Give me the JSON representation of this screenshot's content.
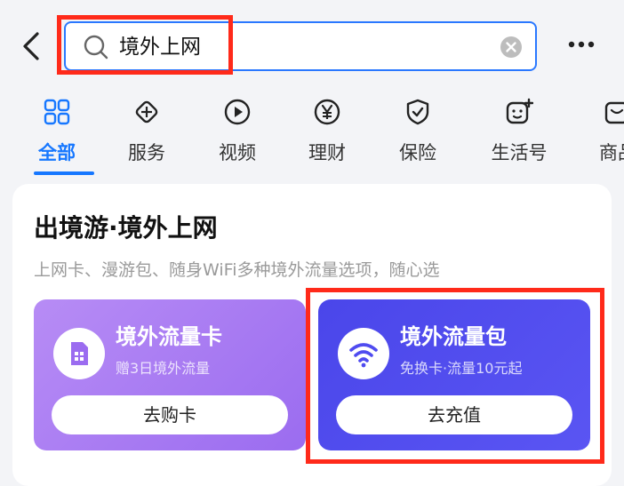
{
  "search": {
    "query": "境外上网"
  },
  "tabs": [
    {
      "label": "全部",
      "icon": "grid-icon",
      "active": true
    },
    {
      "label": "服务",
      "icon": "cube-icon"
    },
    {
      "label": "视频",
      "icon": "play-icon"
    },
    {
      "label": "理财",
      "icon": "yen-icon"
    },
    {
      "label": "保险",
      "icon": "shield-check-icon"
    },
    {
      "label": "生活号",
      "icon": "face-plus-icon"
    },
    {
      "label": "商品",
      "icon": "shop-icon"
    }
  ],
  "card": {
    "title": "出境游·境外上网",
    "subtitle": "上网卡、漫游包、随身WiFi多种境外流量选项，随心选",
    "promos": [
      {
        "title": "境外流量卡",
        "subtitle": "赠3日境外流量",
        "button": "去购卡",
        "icon": "sim-card-icon",
        "color": "#a77cf2"
      },
      {
        "title": "境外流量包",
        "subtitle": "免换卡·流量10元起",
        "button": "去充值",
        "icon": "wifi-icon",
        "color": "#4f4bf0"
      }
    ]
  },
  "colors": {
    "accent": "#1677ff",
    "highlight": "#ff2a1a"
  }
}
